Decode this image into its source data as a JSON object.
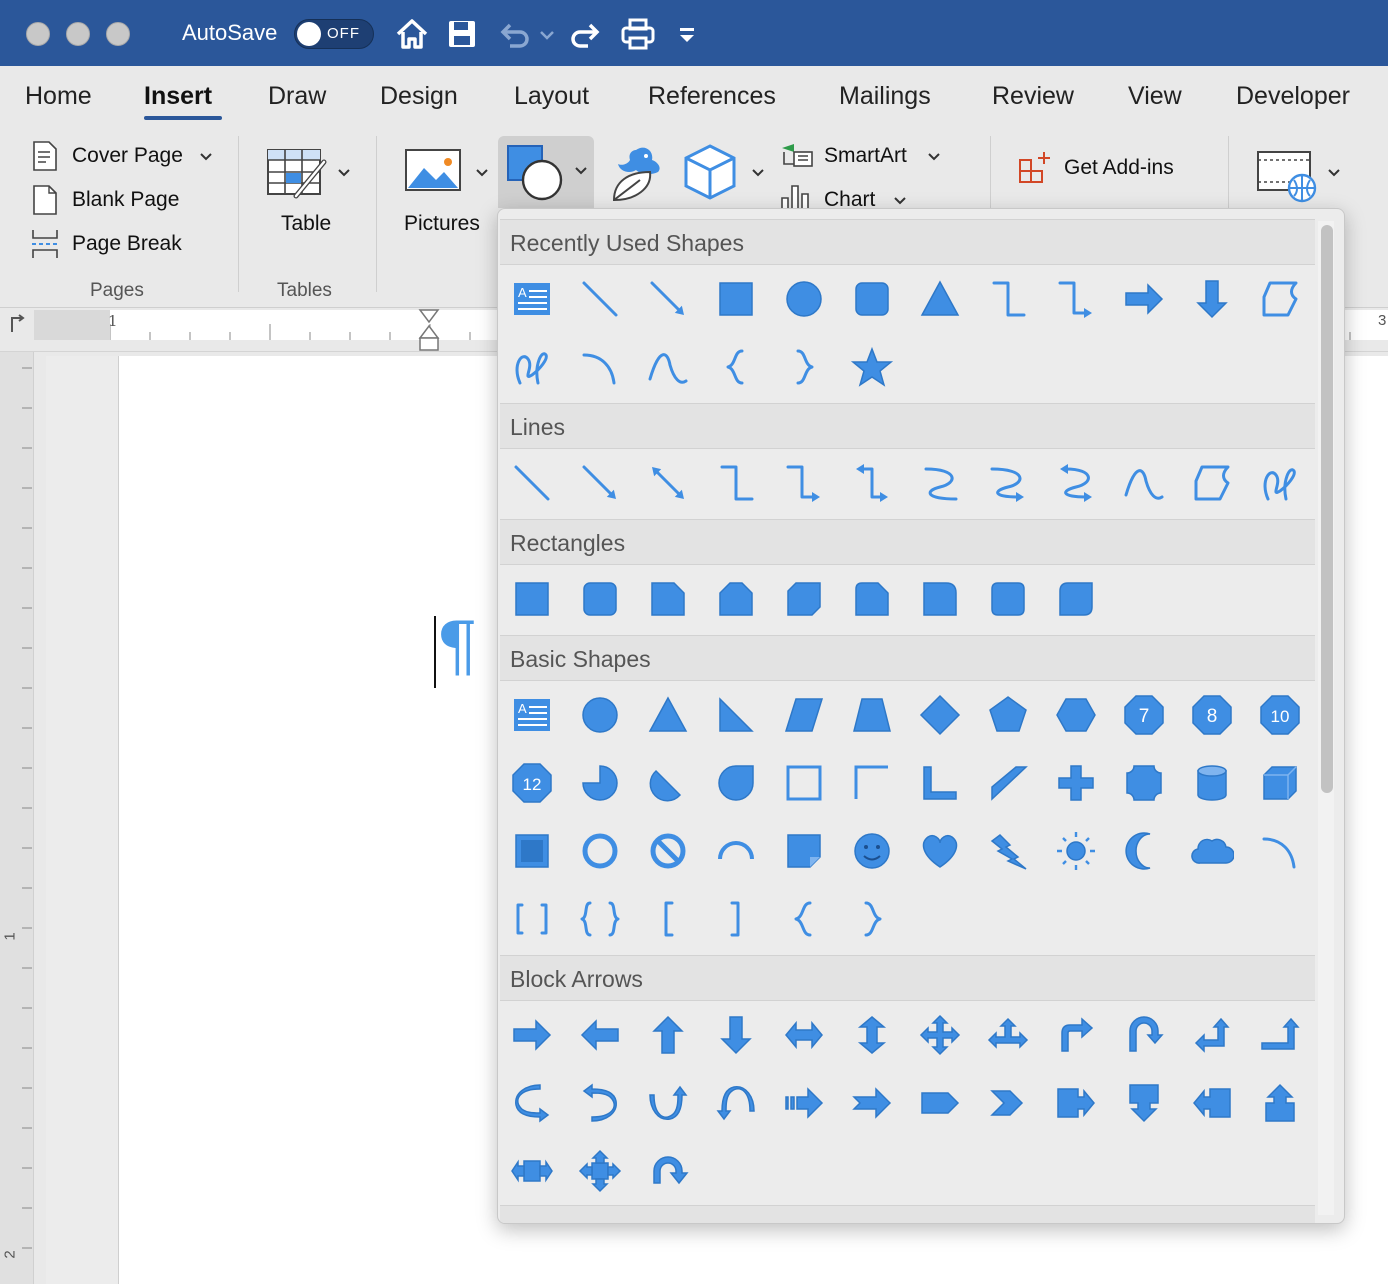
{
  "titlebar": {
    "autosave_label": "AutoSave",
    "autosave_state": "OFF"
  },
  "tabs": [
    "Home",
    "Insert",
    "Draw",
    "Design",
    "Layout",
    "References",
    "Mailings",
    "Review",
    "View",
    "Developer"
  ],
  "active_tab": "Insert",
  "ribbon": {
    "pages": {
      "cover_page": "Cover Page",
      "blank_page": "Blank Page",
      "page_break": "Page Break",
      "group": "Pages"
    },
    "tables": {
      "table": "Table",
      "group": "Tables"
    },
    "pictures": "Pictures",
    "smartart": "SmartArt",
    "chart": "Chart",
    "get_addins": "Get Add-ins"
  },
  "ruler": {
    "left_mark": "1",
    "right_mark": "3"
  },
  "vruler": {
    "mark1": "1",
    "mark2": "2"
  },
  "document": {
    "pilcrow": "¶"
  },
  "gallery": {
    "sections": {
      "recent": "Recently Used Shapes",
      "lines": "Lines",
      "rectangles": "Rectangles",
      "basic": "Basic Shapes",
      "arrows": "Block Arrows"
    },
    "badge_numbers": [
      "7",
      "8",
      "10",
      "12"
    ]
  },
  "colors": {
    "accent": "#2b579a",
    "shape_blue": "#3f8ee3"
  }
}
